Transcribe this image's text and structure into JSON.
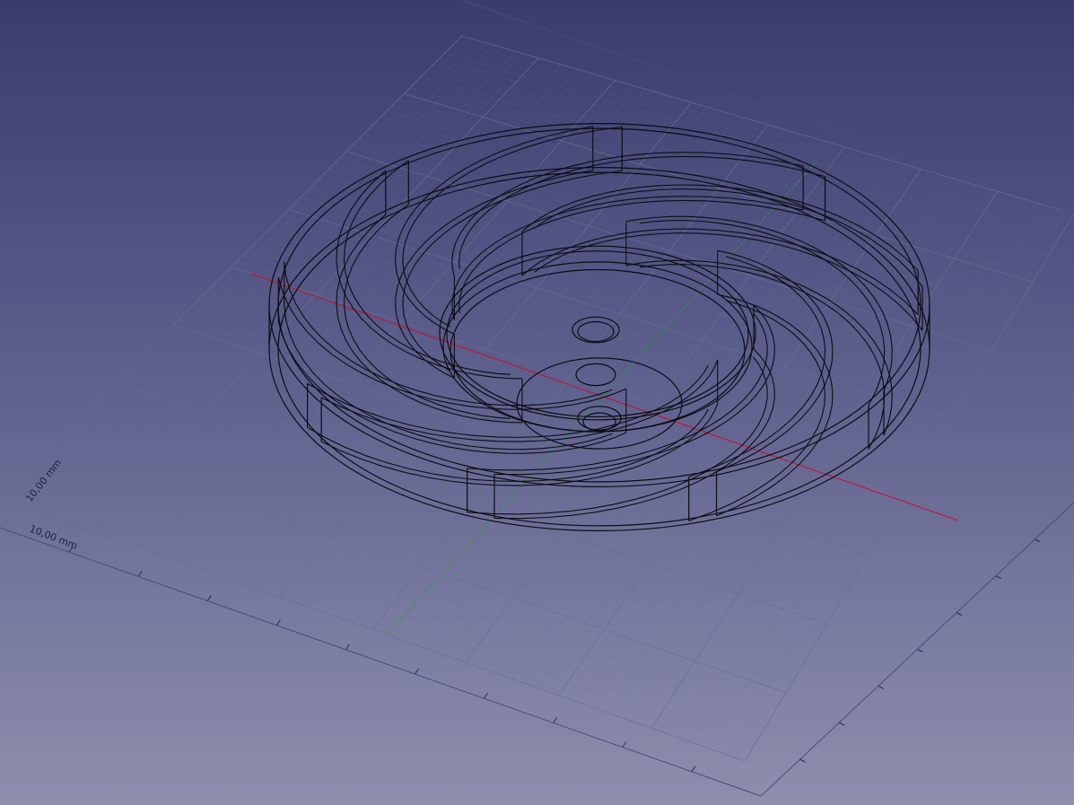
{
  "viewport": {
    "name": "3D view",
    "background_top": "#3a3c6e",
    "background_bottom": "#8e8fad",
    "grid_color": "#6a6d94",
    "axis_x_color": "#c8102e",
    "axis_y_color": "#2e9a3e",
    "model_color": "#0c0c14"
  },
  "grid": {
    "label_vertical": "10,00 mm",
    "label_horizontal": "10,00 mm"
  },
  "model": {
    "name": "impeller",
    "blade_count": 9,
    "view": "wireframe"
  }
}
